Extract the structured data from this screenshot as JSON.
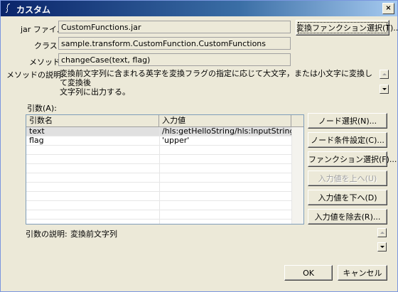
{
  "window": {
    "title": "カスタム",
    "close_label": "×"
  },
  "form": {
    "jar_label": "jar ファイル:",
    "jar_value": "CustomFunctions.jar",
    "select_function_button": "変換ファンクション選択(T)...",
    "class_label": "クラス:",
    "class_value": "sample.transform.CustomFunction.CustomFunctions",
    "method_label": "メソッド:",
    "method_value": "changeCase(text, flag)",
    "method_desc_label": "メソッドの説明:",
    "method_desc_line1": "変換前文字列に含まれる英字を変換フラグの指定に応じて大文字，または小文字に変換して変換後",
    "method_desc_line2": "文字列に出力する。"
  },
  "args": {
    "label": "引数(A):",
    "columns": [
      "引数名",
      "入力値"
    ],
    "rows": [
      {
        "name": "text",
        "value": "/hls:getHelloString/hls:InputString"
      },
      {
        "name": "flag",
        "value": "'upper'"
      }
    ],
    "arg_desc_label": "引数の説明:",
    "arg_desc_value": "変換前文字列"
  },
  "side_buttons": {
    "node_select": "ノード選択(N)...",
    "node_condition": "ノード条件設定(C)...",
    "function_select": "ファンクション選択(F)...",
    "move_up": "入力値を上へ(U)",
    "move_down": "入力値を下へ(D)",
    "remove": "入力値を除去(R)..."
  },
  "footer": {
    "ok": "OK",
    "cancel": "キャンセル"
  },
  "icons": {
    "title_icon": "custom-function-icon",
    "scroll_up": "arrow-up-icon",
    "scroll_down": "arrow-down-icon"
  },
  "colors": {
    "titlebar_start": "#0a246a",
    "titlebar_end": "#a6caf0",
    "dialog_bg": "#ece9d8"
  }
}
